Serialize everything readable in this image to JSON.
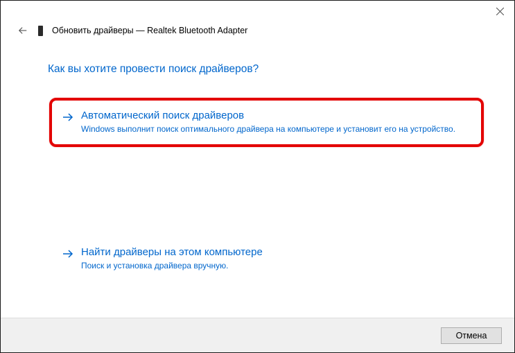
{
  "header": {
    "title": "Обновить драйверы — Realtek Bluetooth Adapter"
  },
  "content": {
    "question": "Как вы хотите провести поиск драйверов?",
    "option1": {
      "title": "Автоматический поиск драйверов",
      "desc": "Windows выполнит поиск оптимального драйвера на компьютере и установит его на устройство."
    },
    "option2": {
      "title": "Найти драйверы на этом компьютере",
      "desc": "Поиск и установка драйвера вручную."
    }
  },
  "footer": {
    "cancel": "Отмена"
  }
}
